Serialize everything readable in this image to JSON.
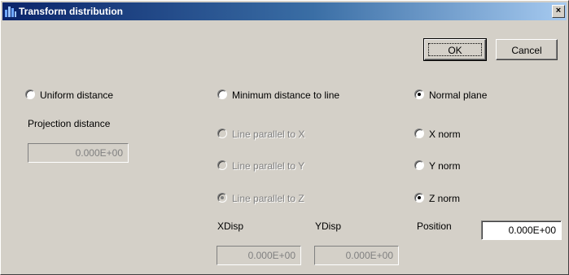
{
  "window": {
    "title": "Transform distribution",
    "close_label": "×"
  },
  "buttons": {
    "ok": "OK",
    "cancel": "Cancel"
  },
  "mode": {
    "uniform": "Uniform distance",
    "minimum": "Minimum distance to line",
    "normal": "Normal plane",
    "selected": "Normal plane"
  },
  "projection": {
    "label": "Projection distance",
    "value": "0.000E+00"
  },
  "lines": {
    "x": "Line parallel to X",
    "y": "Line parallel to Y",
    "z": "Line parallel to Z",
    "selected": "Line parallel to Z"
  },
  "norms": {
    "x": "X norm",
    "y": "Y norm",
    "z": "Z norm",
    "selected": "Z norm"
  },
  "disp": {
    "xlabel": "XDisp",
    "ylabel": "YDisp",
    "xvalue": "0.000E+00",
    "yvalue": "0.000E+00"
  },
  "position": {
    "label": "Position",
    "value": "0.000E+00"
  }
}
